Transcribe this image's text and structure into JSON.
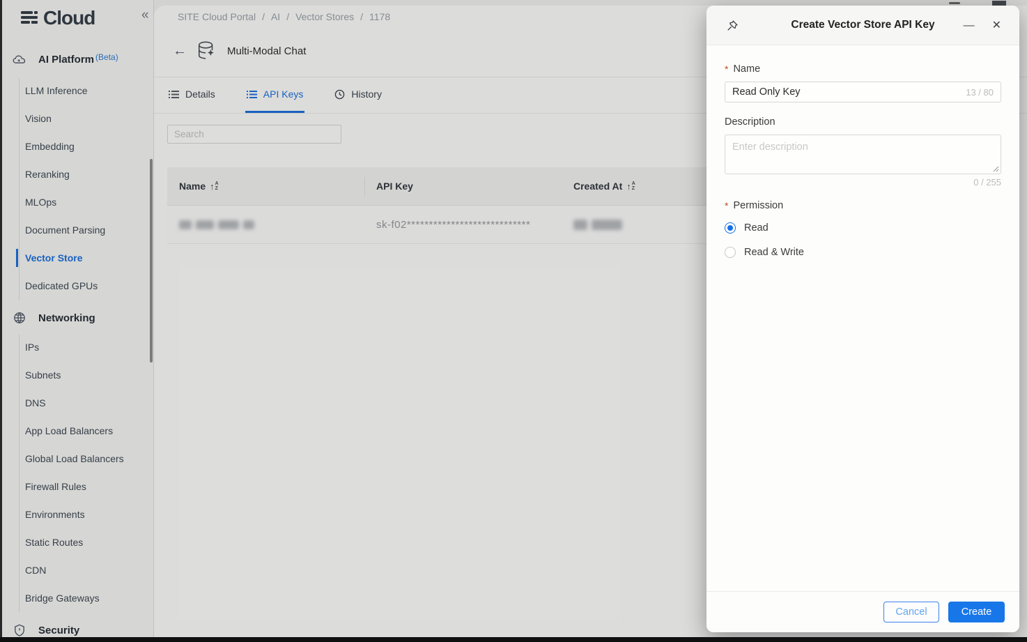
{
  "brand": {
    "logo_text": "Cloud"
  },
  "icons": {
    "collapse": "«",
    "back": "←",
    "minimize": "—",
    "close": "✕",
    "sort_arrow": "↑",
    "sort_a": "A",
    "sort_z": "Z"
  },
  "breadcrumb": {
    "separator": "/",
    "items": [
      "SITE Cloud Portal",
      "AI",
      "Vector Stores",
      "1178"
    ]
  },
  "sidebar": {
    "sections": [
      {
        "label": "AI Platform",
        "badge": "(Beta)",
        "items": [
          "LLM Inference",
          "Vision",
          "Embedding",
          "Reranking",
          "MLOps",
          "Document Parsing",
          "Vector Store",
          "Dedicated GPUs"
        ],
        "active_item": "Vector Store"
      },
      {
        "label": "Networking",
        "items": [
          "IPs",
          "Subnets",
          "DNS",
          "App Load Balancers",
          "Global Load Balancers",
          "Firewall Rules",
          "Environments",
          "Static Routes",
          "CDN",
          "Bridge Gateways"
        ]
      },
      {
        "label": "Security",
        "items": []
      }
    ]
  },
  "page": {
    "title": "Multi-Modal Chat"
  },
  "tabs": [
    {
      "label": "Details",
      "active": false
    },
    {
      "label": "API Keys",
      "active": true
    },
    {
      "label": "History",
      "active": false
    }
  ],
  "search": {
    "placeholder": "Search"
  },
  "table": {
    "columns": [
      {
        "label": "Name",
        "sortable": true
      },
      {
        "label": "API Key",
        "sortable": false
      },
      {
        "label": "Created At",
        "sortable": true
      }
    ],
    "rows": [
      {
        "name_redacted": true,
        "api_key": "sk-f02****************************",
        "created_at_redacted": true
      }
    ]
  },
  "modal": {
    "title": "Create Vector Store API Key",
    "fields": {
      "name": {
        "label": "Name",
        "required": true,
        "value": "Read Only Key",
        "counter": "13 / 80"
      },
      "description": {
        "label": "Description",
        "placeholder": "Enter description",
        "counter": "0 / 255"
      },
      "permission": {
        "label": "Permission",
        "required": true,
        "options": [
          {
            "label": "Read",
            "selected": true
          },
          {
            "label": "Read & Write",
            "selected": false
          }
        ]
      }
    },
    "buttons": {
      "cancel": "Cancel",
      "create": "Create"
    }
  },
  "colors": {
    "accent_blue": "#1877e8",
    "active_nav_blue": "#1a6fdc",
    "required_star": "#bf4f1f"
  }
}
